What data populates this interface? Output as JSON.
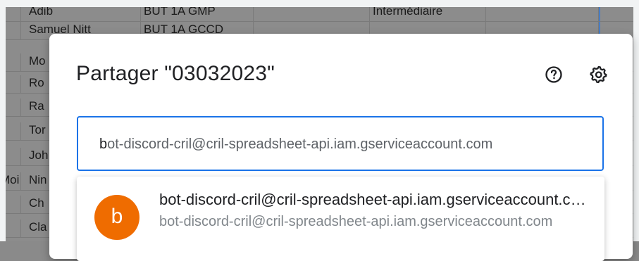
{
  "sheet_rows": [
    {
      "a": "",
      "b": "Adib",
      "c": "BUT 1A GMP",
      "d": "",
      "e": "Intermédiaire"
    },
    {
      "a": "",
      "b": "Samuel Nitt",
      "c": "BUT 1A GCCD",
      "d": "",
      "e": ""
    },
    {
      "a": "",
      "b": "Mo",
      "c": "",
      "d": "",
      "e": ""
    },
    {
      "a": "",
      "b": "Ro",
      "c": "",
      "d": "",
      "e": ""
    },
    {
      "a": "",
      "b": "Ra",
      "c": "",
      "d": "",
      "e": ""
    },
    {
      "a": "",
      "b": "Tor",
      "c": "",
      "d": "",
      "e": ""
    },
    {
      "a": "",
      "b": "Joh",
      "c": "",
      "d": "",
      "e": ""
    },
    {
      "a": "Moi",
      "b": "Nin",
      "c": "",
      "d": "",
      "e": ""
    },
    {
      "a": "",
      "b": "Ch",
      "c": "",
      "d": "",
      "e": ""
    },
    {
      "a": "",
      "b": "Cla",
      "c": "",
      "d": "",
      "e": ""
    }
  ],
  "dialog": {
    "title": "Partager \"03032023\"",
    "help_icon": "help-circle-icon",
    "settings_icon": "gear-icon",
    "input": {
      "typed": "b",
      "completion": "ot-discord-cril@cril-spreadsheet-api.iam.gserviceaccount.com"
    },
    "suggestion": {
      "avatar_letter": "b",
      "avatar_color": "#ef6c00",
      "name": "bot-discord-cril@cril-spreadsheet-api.iam.gserviceaccount.com",
      "email": "bot-discord-cril@cril-spreadsheet-api.iam.gserviceaccount.com"
    }
  },
  "colors": {
    "accent": "#1a73e8",
    "overlay_bg": "#8c8c8c"
  }
}
